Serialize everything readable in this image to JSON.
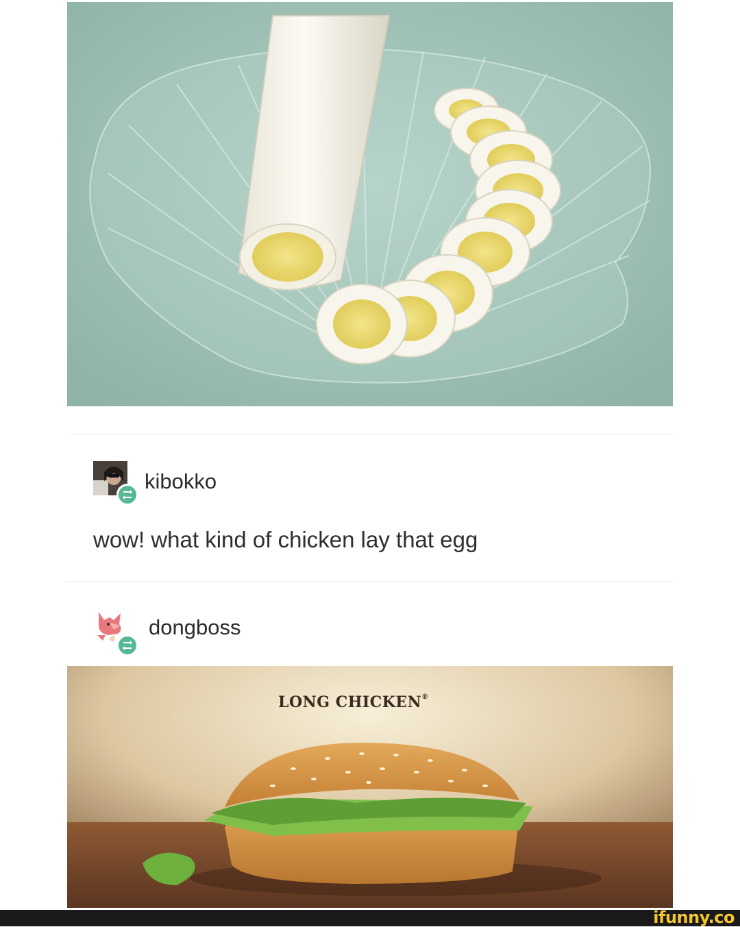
{
  "egg_image": {
    "alt_icon": "long-egg-photo"
  },
  "posts": [
    {
      "username": "kibokko",
      "avatar_icon": "kibokko-avatar-icon",
      "badge_icon": "reblog-icon",
      "text": "wow! what kind of chicken lay that egg"
    },
    {
      "username": "dongboss",
      "avatar_icon": "fox-avatar-icon",
      "badge_icon": "reblog-icon"
    }
  ],
  "chicken_image": {
    "title": "LONG CHICKEN",
    "trademark": "®"
  },
  "watermark": {
    "text": "ifunny.co"
  },
  "colors": {
    "reblog_badge": "#56b894",
    "watermark": "#f6c62e",
    "egg_background": "#a9c7bd"
  }
}
